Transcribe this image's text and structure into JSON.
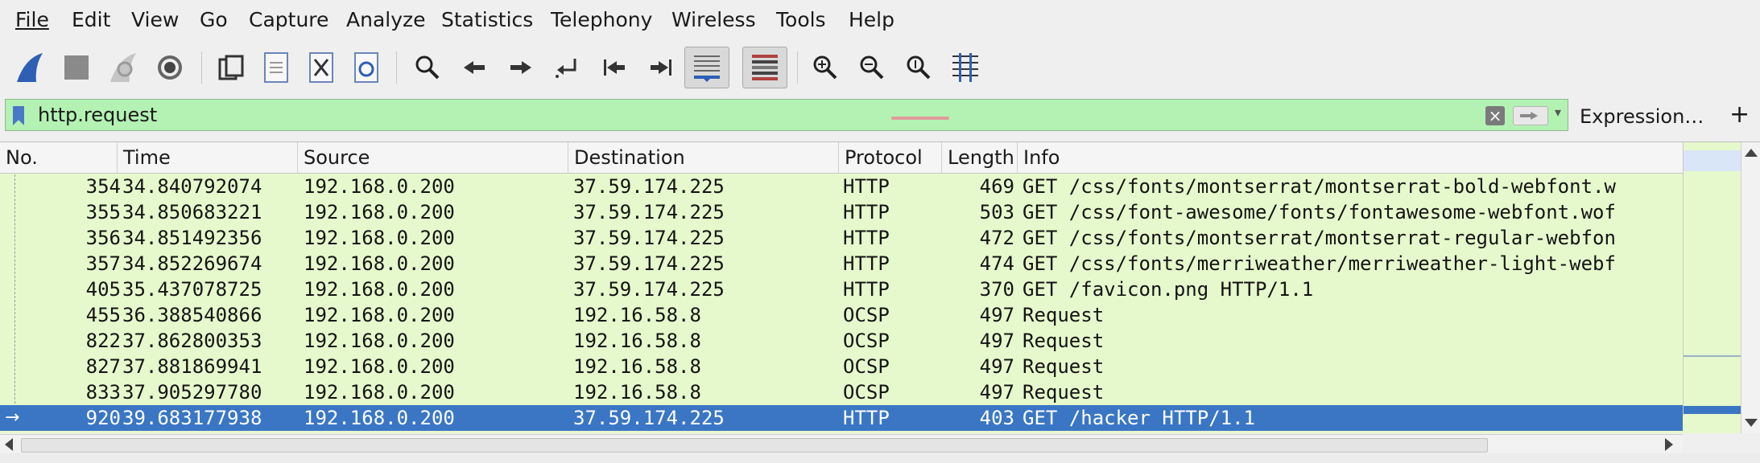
{
  "menu": [
    "File",
    "Edit",
    "View",
    "Go",
    "Capture",
    "Analyze",
    "Statistics",
    "Telephony",
    "Wireless",
    "Tools",
    "Help"
  ],
  "toolbar": {
    "icons": [
      "shark-fin-start-icon",
      "stop-capture-icon",
      "restart-capture-icon",
      "capture-options-icon",
      "open-file-icon",
      "save-file-icon",
      "close-file-icon",
      "reload-file-icon",
      "find-packet-icon",
      "go-back-icon",
      "go-forward-icon",
      "go-to-packet-icon",
      "first-packet-icon",
      "last-packet-icon",
      "auto-scroll-icon",
      "colorize-icon",
      "zoom-in-icon",
      "zoom-out-icon",
      "normal-size-icon",
      "resize-columns-icon"
    ]
  },
  "filter": {
    "value": "http.request",
    "clear_symbol": "×",
    "expression_label": "Expression…",
    "add_label": "+",
    "background": "#b3f2b3"
  },
  "columns": [
    "No.",
    "Time",
    "Source",
    "Destination",
    "Protocol",
    "Length",
    "Info"
  ],
  "packets": [
    {
      "no": "354",
      "time": "34.840792074",
      "src": "192.168.0.200",
      "dst": "37.59.174.225",
      "proto": "HTTP",
      "len": "469",
      "info": "GET /css/fonts/montserrat/montserrat-bold-webfont.w"
    },
    {
      "no": "355",
      "time": "34.850683221",
      "src": "192.168.0.200",
      "dst": "37.59.174.225",
      "proto": "HTTP",
      "len": "503",
      "info": "GET /css/font-awesome/fonts/fontawesome-webfont.wof"
    },
    {
      "no": "356",
      "time": "34.851492356",
      "src": "192.168.0.200",
      "dst": "37.59.174.225",
      "proto": "HTTP",
      "len": "472",
      "info": "GET /css/fonts/montserrat/montserrat-regular-webfon"
    },
    {
      "no": "357",
      "time": "34.852269674",
      "src": "192.168.0.200",
      "dst": "37.59.174.225",
      "proto": "HTTP",
      "len": "474",
      "info": "GET /css/fonts/merriweather/merriweather-light-webf"
    },
    {
      "no": "405",
      "time": "35.437078725",
      "src": "192.168.0.200",
      "dst": "37.59.174.225",
      "proto": "HTTP",
      "len": "370",
      "info": "GET /favicon.png HTTP/1.1"
    },
    {
      "no": "455",
      "time": "36.388540866",
      "src": "192.168.0.200",
      "dst": "192.16.58.8",
      "proto": "OCSP",
      "len": "497",
      "info": "Request"
    },
    {
      "no": "822",
      "time": "37.862800353",
      "src": "192.168.0.200",
      "dst": "192.16.58.8",
      "proto": "OCSP",
      "len": "497",
      "info": "Request"
    },
    {
      "no": "827",
      "time": "37.881869941",
      "src": "192.168.0.200",
      "dst": "192.16.58.8",
      "proto": "OCSP",
      "len": "497",
      "info": "Request"
    },
    {
      "no": "833",
      "time": "37.905297780",
      "src": "192.168.0.200",
      "dst": "192.16.58.8",
      "proto": "OCSP",
      "len": "497",
      "info": "Request"
    },
    {
      "no": "920",
      "time": "39.683177938",
      "src": "192.168.0.200",
      "dst": "37.59.174.225",
      "proto": "HTTP",
      "len": "403",
      "info": "GET /hacker HTTP/1.1",
      "selected": true
    }
  ],
  "colors": {
    "row_background": "#e6f9cc",
    "selected_row": "#3a76c4",
    "accent_blue": "#2e5fb5"
  }
}
